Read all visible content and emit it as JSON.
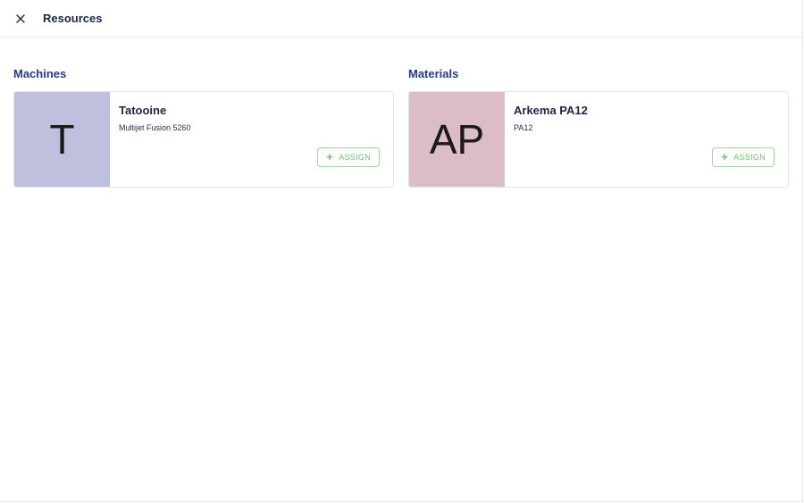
{
  "header": {
    "title": "Resources"
  },
  "sections": [
    {
      "title": "Machines",
      "card": {
        "initials": "T",
        "name": "Tatooine",
        "subtitle": "Multijet Fusion 5260",
        "avatar_color": "#bec0dd",
        "button_label": "ASSIGN",
        "button_icon": "+"
      }
    },
    {
      "title": "Materials",
      "card": {
        "initials": "AP",
        "name": "Arkema PA12",
        "subtitle": "PA12",
        "avatar_color": "#dbbcc7",
        "button_label": "ASSIGN",
        "button_icon": "+"
      }
    }
  ],
  "colors": {
    "accent_text": "#253a8c",
    "assign_green": "#6bc46a"
  }
}
